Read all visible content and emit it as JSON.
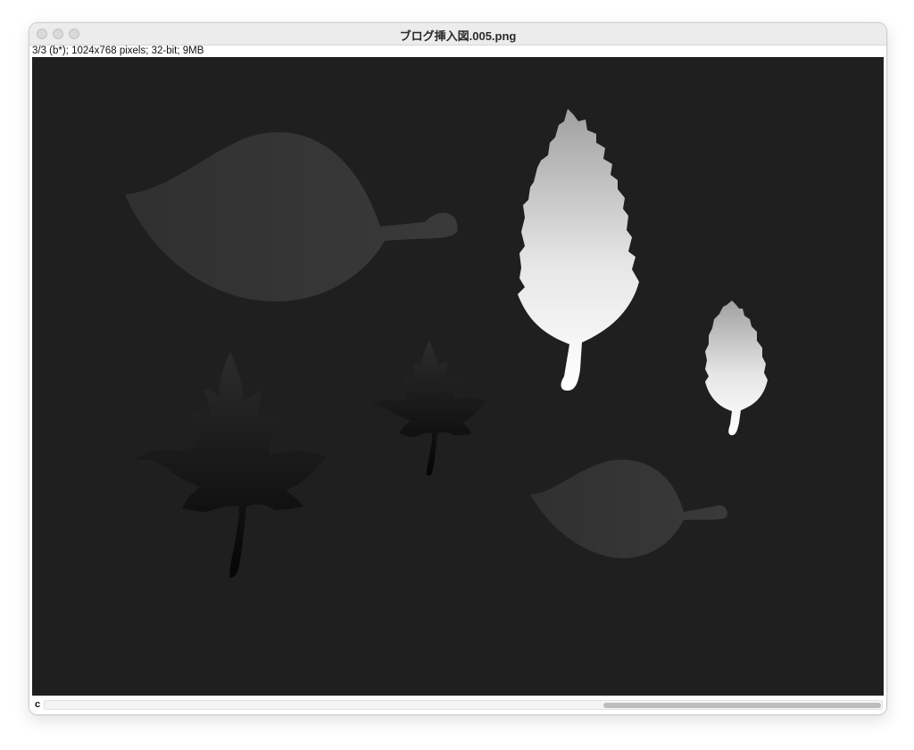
{
  "window": {
    "title": "ブログ挿入図.005.png",
    "info": "3/3 (b*); 1024x768 pixels; 32-bit; 9MB",
    "traffic_lights": [
      "close",
      "minimize",
      "zoom"
    ]
  },
  "statusbar": {
    "channel_label": "c"
  },
  "image": {
    "background": "#1f1f1f",
    "shapes": [
      "large-leaf-dim",
      "small-leaf-dim",
      "large-maple-leaf-dark",
      "small-maple-leaf-dark",
      "large-elm-leaf-bright",
      "small-elm-leaf-bright"
    ]
  },
  "colors": {
    "titlebar": "#ececec",
    "canvas_bg": "#1f1f1f",
    "scroll_thumb": "#bdbdbd"
  }
}
